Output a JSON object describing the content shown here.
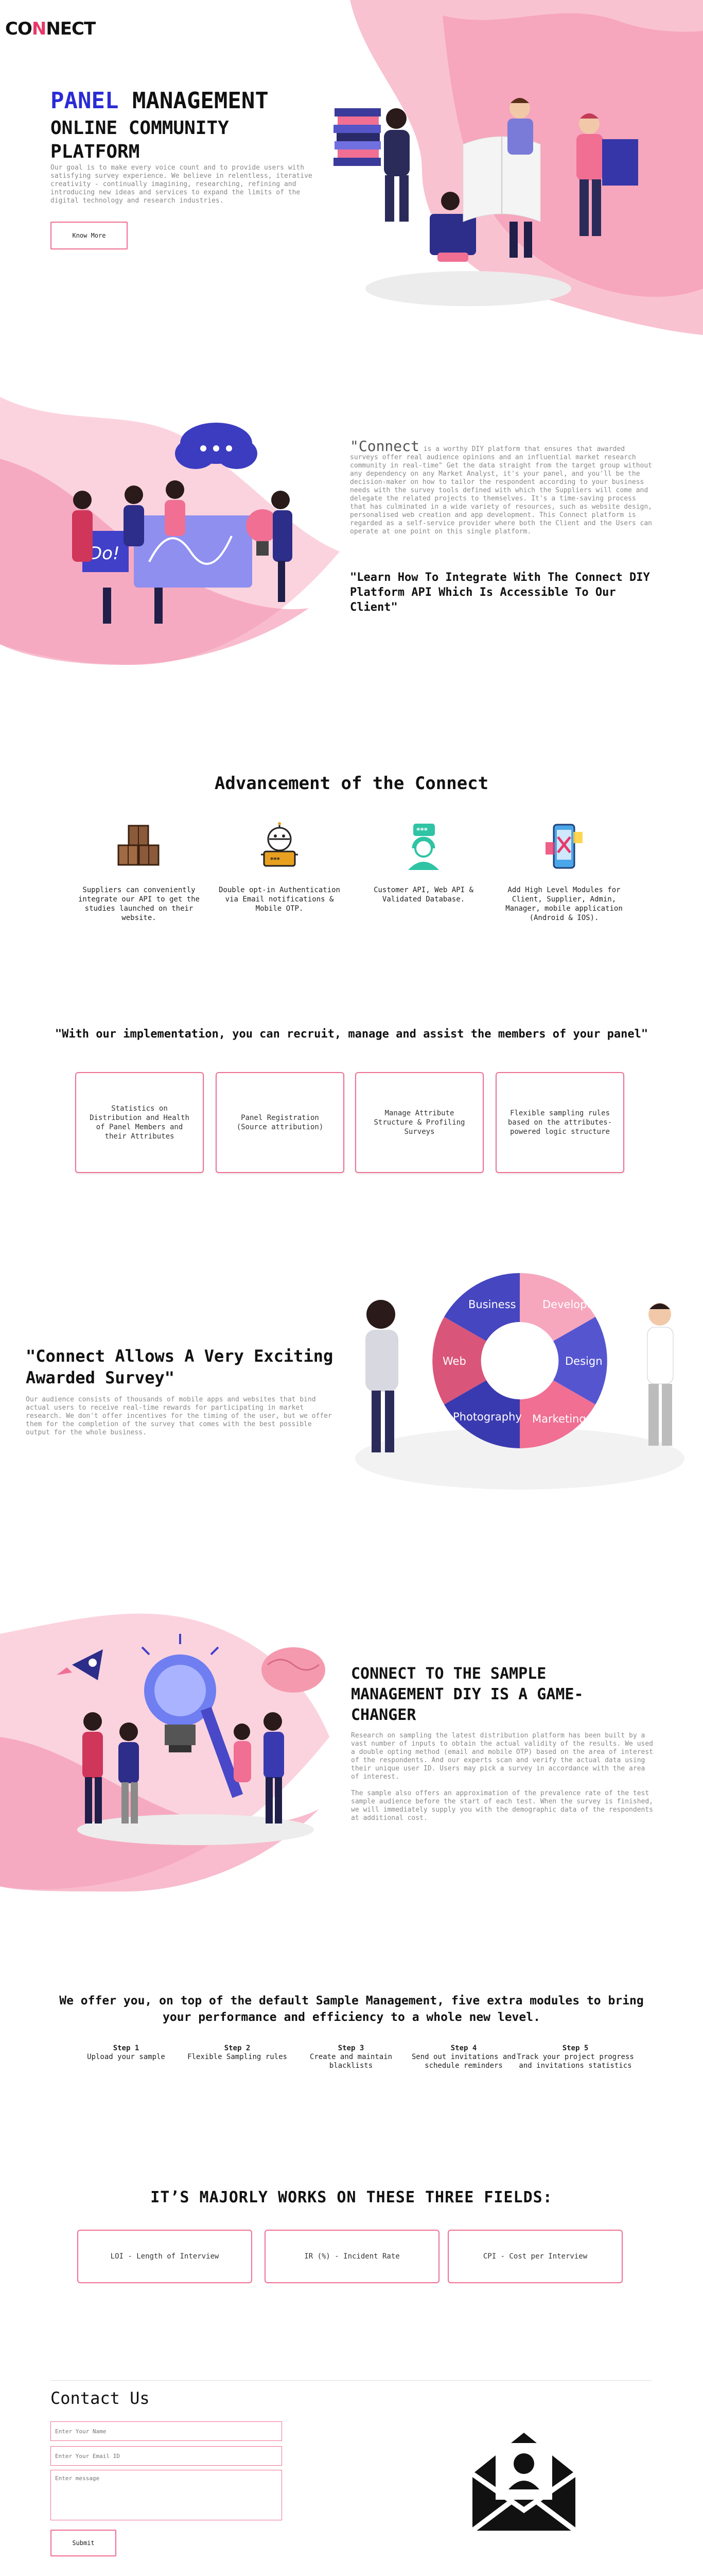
{
  "header": {
    "logo_prefix": "CO",
    "logo_mark": "N",
    "logo_suffix": "NECT",
    "menu_icon": "hamburger-icon"
  },
  "hero": {
    "title_accent": "PANEL",
    "title_rest": " MANAGEMENT",
    "subtitle": "ONLINE COMMUNITY PLATFORM",
    "description": "Our goal is to make every voice count and to provide users with satisfying survey experience. We believe in relentless, iterative creativity - continually imagining, researching, refining and introducing new ideas and services to expand the limits of the digital technology and research industries.",
    "button": "Know More"
  },
  "about": {
    "quote_word": "\"Connect",
    "text": " is a worthy DIY platform that ensures that awarded surveys offer real audience opinions and an influential market research community in real-time\" Get the data straight from the target group without any dependency on any Market Analyst, it's your panel, and you'll be the decision-maker on how to tailor the respondent according to your business needs with the survey tools defined with which the Suppliers will come and delegate the related projects to themselves. It's a time-saving process that has culminated in a wide variety of resources, such as website design, personalised web creation and app development. This Connect platform is regarded as a self-service provider where both the Client and the Users can operate at one point on this single platform.",
    "highlight": "\"Learn How To Integrate With The Connect DIY Platform API Which Is Accessible To Our Client\""
  },
  "advancement": {
    "title": "Advancement of the Connect",
    "items": [
      {
        "icon": "boxes-icon",
        "text": "Suppliers can conveniently integrate our API to get the studies launched on their website."
      },
      {
        "icon": "robot-otp-icon",
        "text": "Double opt-in Authentication via Email notifications & Mobile OTP."
      },
      {
        "icon": "support-agent-icon",
        "text": "Customer API, Web API & Validated Database."
      },
      {
        "icon": "mobile-app-icon",
        "text": "Add High Level Modules for Client, Supplier, Admin, Manager, mobile application (Android & IOS)."
      }
    ]
  },
  "implementation": {
    "title": "\"With our implementation, you can recruit, manage and assist the members of your panel\"",
    "cards": [
      "Statistics on Distribution and Health of Panel Members and their Attributes",
      "Panel Registration (Source attribution)",
      "Manage Attribute Structure & Profiling Surveys",
      "Flexible sampling rules based on the attributes-powered logic structure"
    ]
  },
  "survey": {
    "title": "\"Connect Allows A Very Exciting Awarded Survey\"",
    "description": "Our audience consists of thousands of mobile apps and websites that bind actual users to receive real-time rewards for participating in market research. We don't offer incentives for the timing of the user, but we offer them for the completion of the survey that comes with the best possible output for the whole business.",
    "puzzle_labels": [
      "Business",
      "Developer",
      "Design",
      "Marketing",
      "Photography",
      "Web"
    ]
  },
  "game": {
    "title": "CONNECT TO THE SAMPLE MANAGEMENT DIY IS A GAME-CHANGER",
    "paragraph1": "Research on sampling the latest distribution platform has been built by a vast number of inputs to obtain the actual validity of the results. We used a double opting method (email and mobile OTP) based on the area of interest of the respondents. And our experts scan and verify the actual data using their unique user ID. Users may pick a survey in accordance with the area of interest.",
    "paragraph2": "The sample also offers an approximation of the prevalence rate of the test sample audience before the start of each test. When the survey is finished, we will immediately supply you with the demographic data of the respondents at additional cost."
  },
  "offer": {
    "title": "We offer you, on top of the default Sample Management, five extra modules to bring your performance and efficiency to a whole new level.",
    "steps": [
      {
        "label": "Step 1",
        "text": "Upload your sample"
      },
      {
        "label": "Step 2",
        "text": "Flexible Sampling rules"
      },
      {
        "label": "Step 3",
        "text": "Create and maintain blacklists"
      },
      {
        "label": "Step 4",
        "text": "Send out invitations and schedule reminders"
      },
      {
        "label": "Step 5",
        "text": "Track your project progress and invitations statistics"
      }
    ]
  },
  "fields": {
    "title": "IT’S MAJORLY WORKS ON THESE THREE FIELDS:",
    "items": [
      "LOI - Length of Interview",
      "IR (%) - Incident Rate",
      "CPI - Cost per Interview"
    ]
  },
  "contact": {
    "title": "Contact Us",
    "name_placeholder": "Enter Your Name",
    "email_placeholder": "Enter Your Email ID",
    "message_placeholder": "Enter message",
    "submit": "Submit"
  },
  "colors": {
    "accent": "#ef6f93",
    "brand_blue": "#2b2bd6",
    "soft_pink": "#fbd3de"
  }
}
